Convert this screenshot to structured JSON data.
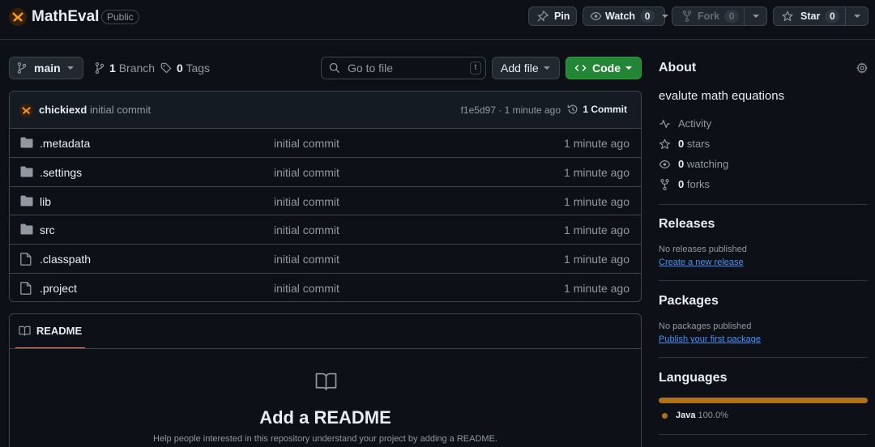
{
  "repo": {
    "name": "MathEval",
    "visibility": "Public"
  },
  "actions": {
    "pin": "Pin",
    "watch": "Watch",
    "watch_count": "0",
    "fork": "Fork",
    "fork_count": "0",
    "star": "Star",
    "star_count": "0"
  },
  "toolbar": {
    "branch": "main",
    "branches_count": "1",
    "branches_label": "Branch",
    "tags_count": "0",
    "tags_label": "Tags",
    "goto_placeholder": "Go to file",
    "goto_shortcut": "t",
    "add_file": "Add file",
    "code": "Code"
  },
  "commit": {
    "author": "chickiexd",
    "message": "initial commit",
    "sha_time": "f1e5d97 · 1 minute ago",
    "count": "1 Commit"
  },
  "files": [
    {
      "name": ".metadata",
      "type": "folder",
      "commit": "initial commit",
      "age": "1 minute ago"
    },
    {
      "name": ".settings",
      "type": "folder",
      "commit": "initial commit",
      "age": "1 minute ago"
    },
    {
      "name": "lib",
      "type": "folder",
      "commit": "initial commit",
      "age": "1 minute ago"
    },
    {
      "name": "src",
      "type": "folder",
      "commit": "initial commit",
      "age": "1 minute ago"
    },
    {
      "name": ".classpath",
      "type": "file",
      "commit": "initial commit",
      "age": "1 minute ago"
    },
    {
      "name": ".project",
      "type": "file",
      "commit": "initial commit",
      "age": "1 minute ago"
    }
  ],
  "readme": {
    "tab": "README",
    "title": "Add a README",
    "subtitle": "Help people interested in this repository understand your project by adding a README."
  },
  "about": {
    "heading": "About",
    "description": "evalute math equations",
    "activity": "Activity",
    "stars_count": "0",
    "stars_label": "stars",
    "watching_count": "0",
    "watching_label": "watching",
    "forks_count": "0",
    "forks_label": "forks"
  },
  "releases": {
    "heading": "Releases",
    "empty": "No releases published",
    "link": "Create a new release"
  },
  "packages": {
    "heading": "Packages",
    "empty": "No packages published",
    "link": "Publish your first package"
  },
  "languages": {
    "heading": "Languages",
    "items": [
      {
        "name": "Java",
        "percent": "100.0%",
        "color": "#b07219"
      }
    ]
  },
  "colors": {
    "background": "#0d1117",
    "accent_green": "#238636",
    "link_blue": "#4493f8",
    "tab_underline": "#f78166"
  }
}
